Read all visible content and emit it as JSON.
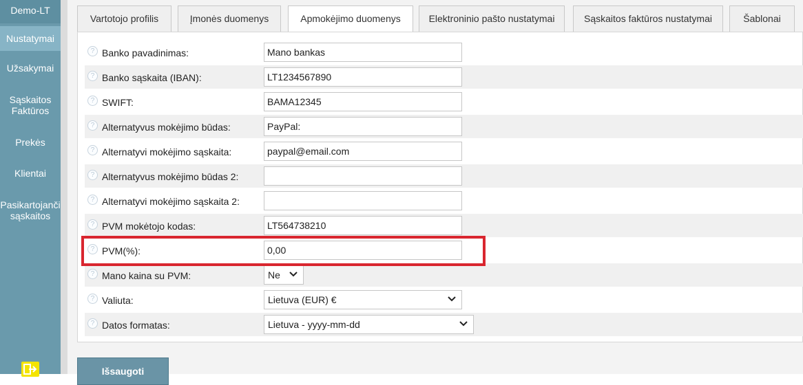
{
  "sidebar": {
    "brand": "Demo-LT",
    "items": [
      {
        "label": "Nustatymai"
      },
      {
        "label": "Užsakymai"
      },
      {
        "label_line1": "Sąskaitos",
        "label_line2": "Faktūros"
      },
      {
        "label": "Prekės"
      },
      {
        "label": "Klientai"
      },
      {
        "label_line1": "Pasikartojanči",
        "label_line2": "sąskaitos"
      }
    ]
  },
  "tabs": [
    {
      "label": "Vartotojo profilis"
    },
    {
      "label": "Įmonės duomenys"
    },
    {
      "label": "Apmokėjimo duomenys"
    },
    {
      "label": "Elektroninio pašto nustatymai"
    },
    {
      "label": "Sąskaitos faktūros nustatymai"
    },
    {
      "label": "Šablonai"
    }
  ],
  "active_tab": "Apmokėjimo duomenys",
  "form": {
    "help_glyph": "?",
    "fields": [
      {
        "label": "Banko pavadinimas:",
        "value": "Mano bankas"
      },
      {
        "label": "Banko sąskaita (IBAN):",
        "value": "LT1234567890"
      },
      {
        "label": "SWIFT:",
        "value": "BAMA12345"
      },
      {
        "label": "Alternatyvus mokėjimo būdas:",
        "value": "PayPal:"
      },
      {
        "label": "Alternatyvi mokėjimo sąskaita:",
        "value": "paypal@email.com"
      },
      {
        "label": "Alternatyvus mokėjimo būdas 2:",
        "value": ""
      },
      {
        "label": "Alternatyvi mokėjimo sąskaita 2:",
        "value": ""
      },
      {
        "label": "PVM mokėtojo kodas:",
        "value": "LT564738210"
      },
      {
        "label": "PVM(%):",
        "value": "0,00"
      }
    ],
    "price_with_vat": {
      "label": "Mano kaina su PVM:",
      "value": "Ne"
    },
    "currency": {
      "label": "Valiuta:",
      "value": "Lietuva (EUR) €"
    },
    "date_format": {
      "label": "Datos formatas:",
      "value": "Lietuva - yyyy-mm-dd"
    }
  },
  "save_label": "Išsaugoti",
  "colors": {
    "sidebar": "#6a9aac",
    "highlight": "#d9262f",
    "button": "#6a94a6"
  }
}
